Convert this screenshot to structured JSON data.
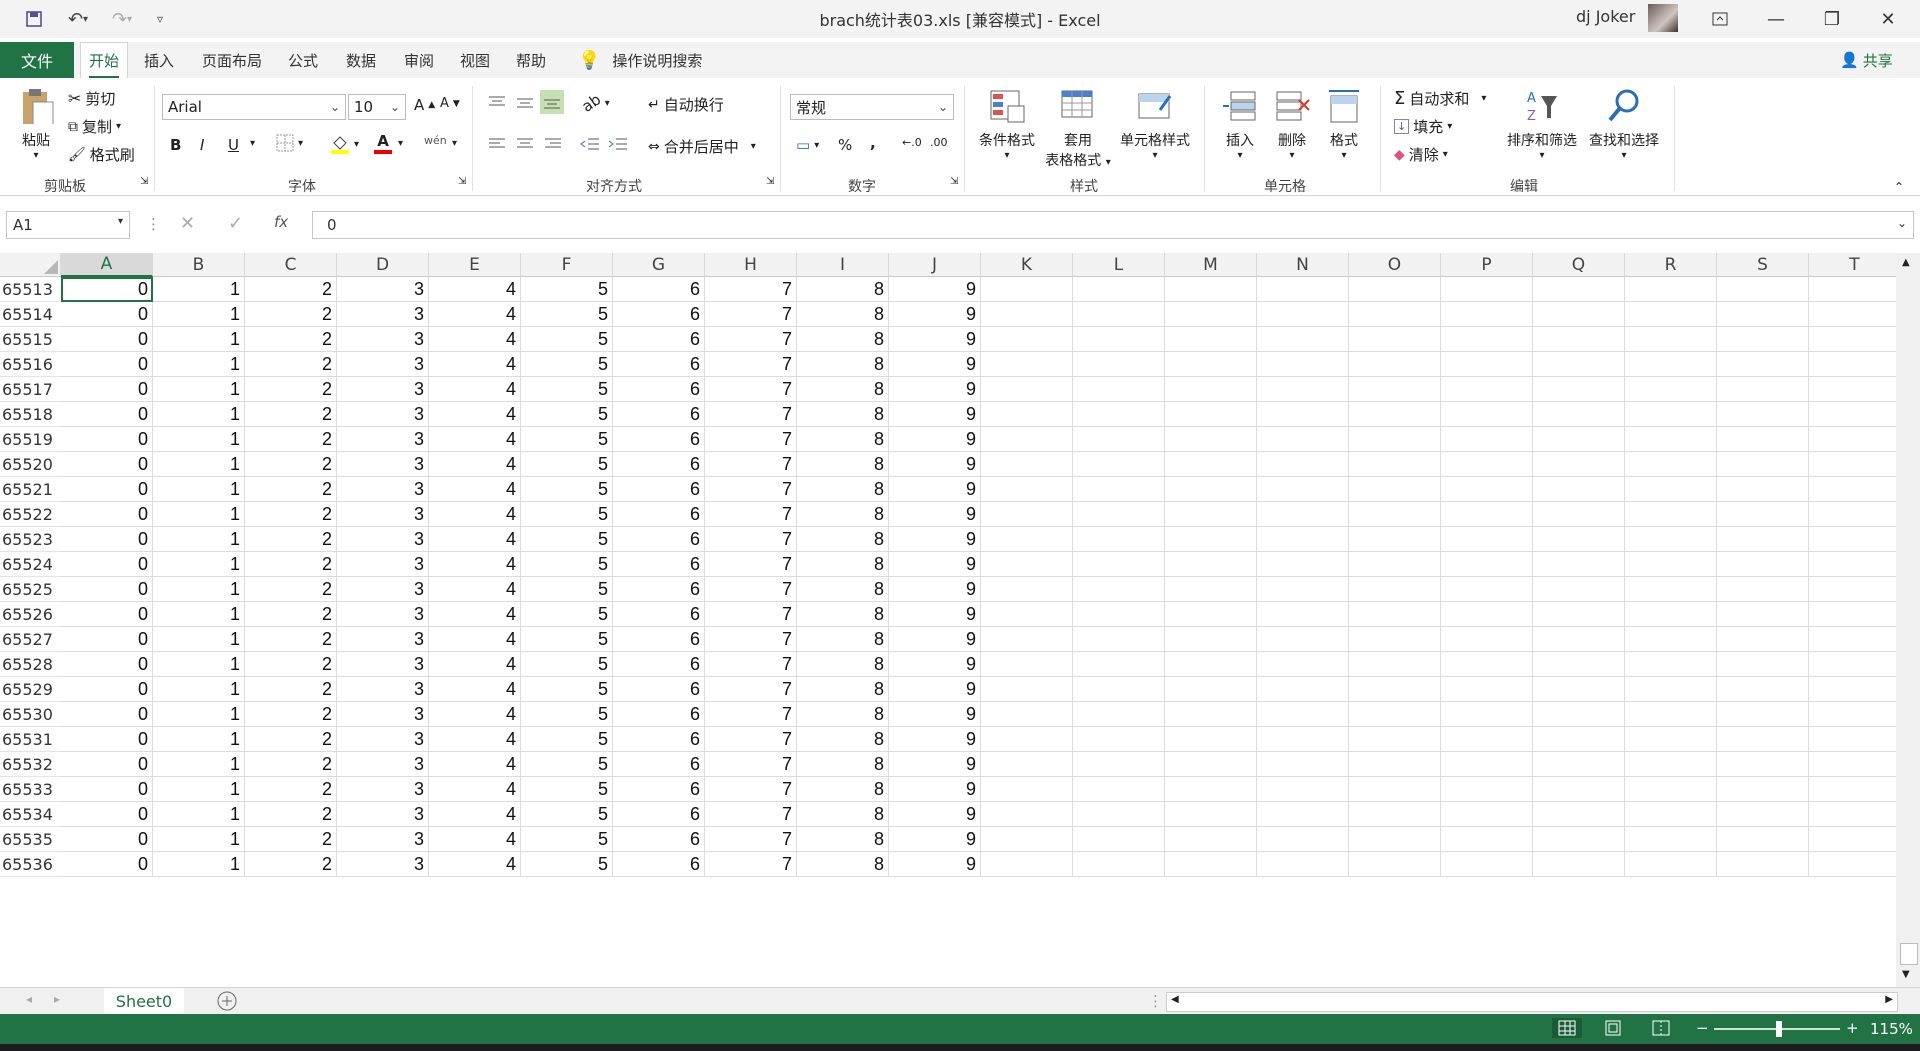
{
  "window": {
    "title": "brach统计表03.xls  [兼容模式]  -  Excel",
    "user": "dj Joker"
  },
  "tabs": [
    "文件",
    "开始",
    "插入",
    "页面布局",
    "公式",
    "数据",
    "审阅",
    "视图",
    "帮助"
  ],
  "tell_me": "操作说明搜索",
  "share": "共享",
  "ribbon": {
    "clipboard": {
      "paste": "粘贴",
      "cut": "剪切",
      "copy": "复制",
      "format_painter": "格式刷",
      "label": "剪贴板"
    },
    "font": {
      "name": "Arial",
      "size": "10",
      "label": "字体",
      "bold": "B",
      "italic": "I",
      "underline": "U",
      "font_color_letter": "A",
      "phonetic": "wén"
    },
    "alignment": {
      "wrap": "自动换行",
      "merge": "合并后居中",
      "label": "对齐方式"
    },
    "number": {
      "format": "常规",
      "label": "数字",
      "percent": "%",
      "comma": ","
    },
    "styles": {
      "conditional": "条件格式",
      "table_line1": "套用",
      "table_line2": "表格格式",
      "cell_styles": "单元格样式",
      "label": "样式"
    },
    "cells": {
      "insert": "插入",
      "delete": "删除",
      "format": "格式",
      "label": "单元格"
    },
    "editing": {
      "autosum": "自动求和",
      "fill": "填充",
      "clear": "清除",
      "sort": "排序和筛选",
      "find": "查找和选择",
      "label": "编辑"
    }
  },
  "formula_bar": {
    "name_box": "A1",
    "fx": "fx",
    "value": "0"
  },
  "columns": [
    "A",
    "B",
    "C",
    "D",
    "E",
    "F",
    "G",
    "H",
    "I",
    "J",
    "K",
    "L",
    "M",
    "N",
    "O",
    "P",
    "Q",
    "R",
    "S",
    "T"
  ],
  "rows": [
    "65513",
    "65514",
    "65515",
    "65516",
    "65517",
    "65518",
    "65519",
    "65520",
    "65521",
    "65522",
    "65523",
    "65524",
    "65525",
    "65526",
    "65527",
    "65528",
    "65529",
    "65530",
    "65531",
    "65532",
    "65533",
    "65534",
    "65535",
    "65536"
  ],
  "row_values": [
    "0",
    "1",
    "2",
    "3",
    "4",
    "5",
    "6",
    "7",
    "8",
    "9"
  ],
  "sheet_tabs": [
    "Sheet0"
  ],
  "status": {
    "zoom": "115%"
  },
  "colors": {
    "accent": "#217346"
  }
}
